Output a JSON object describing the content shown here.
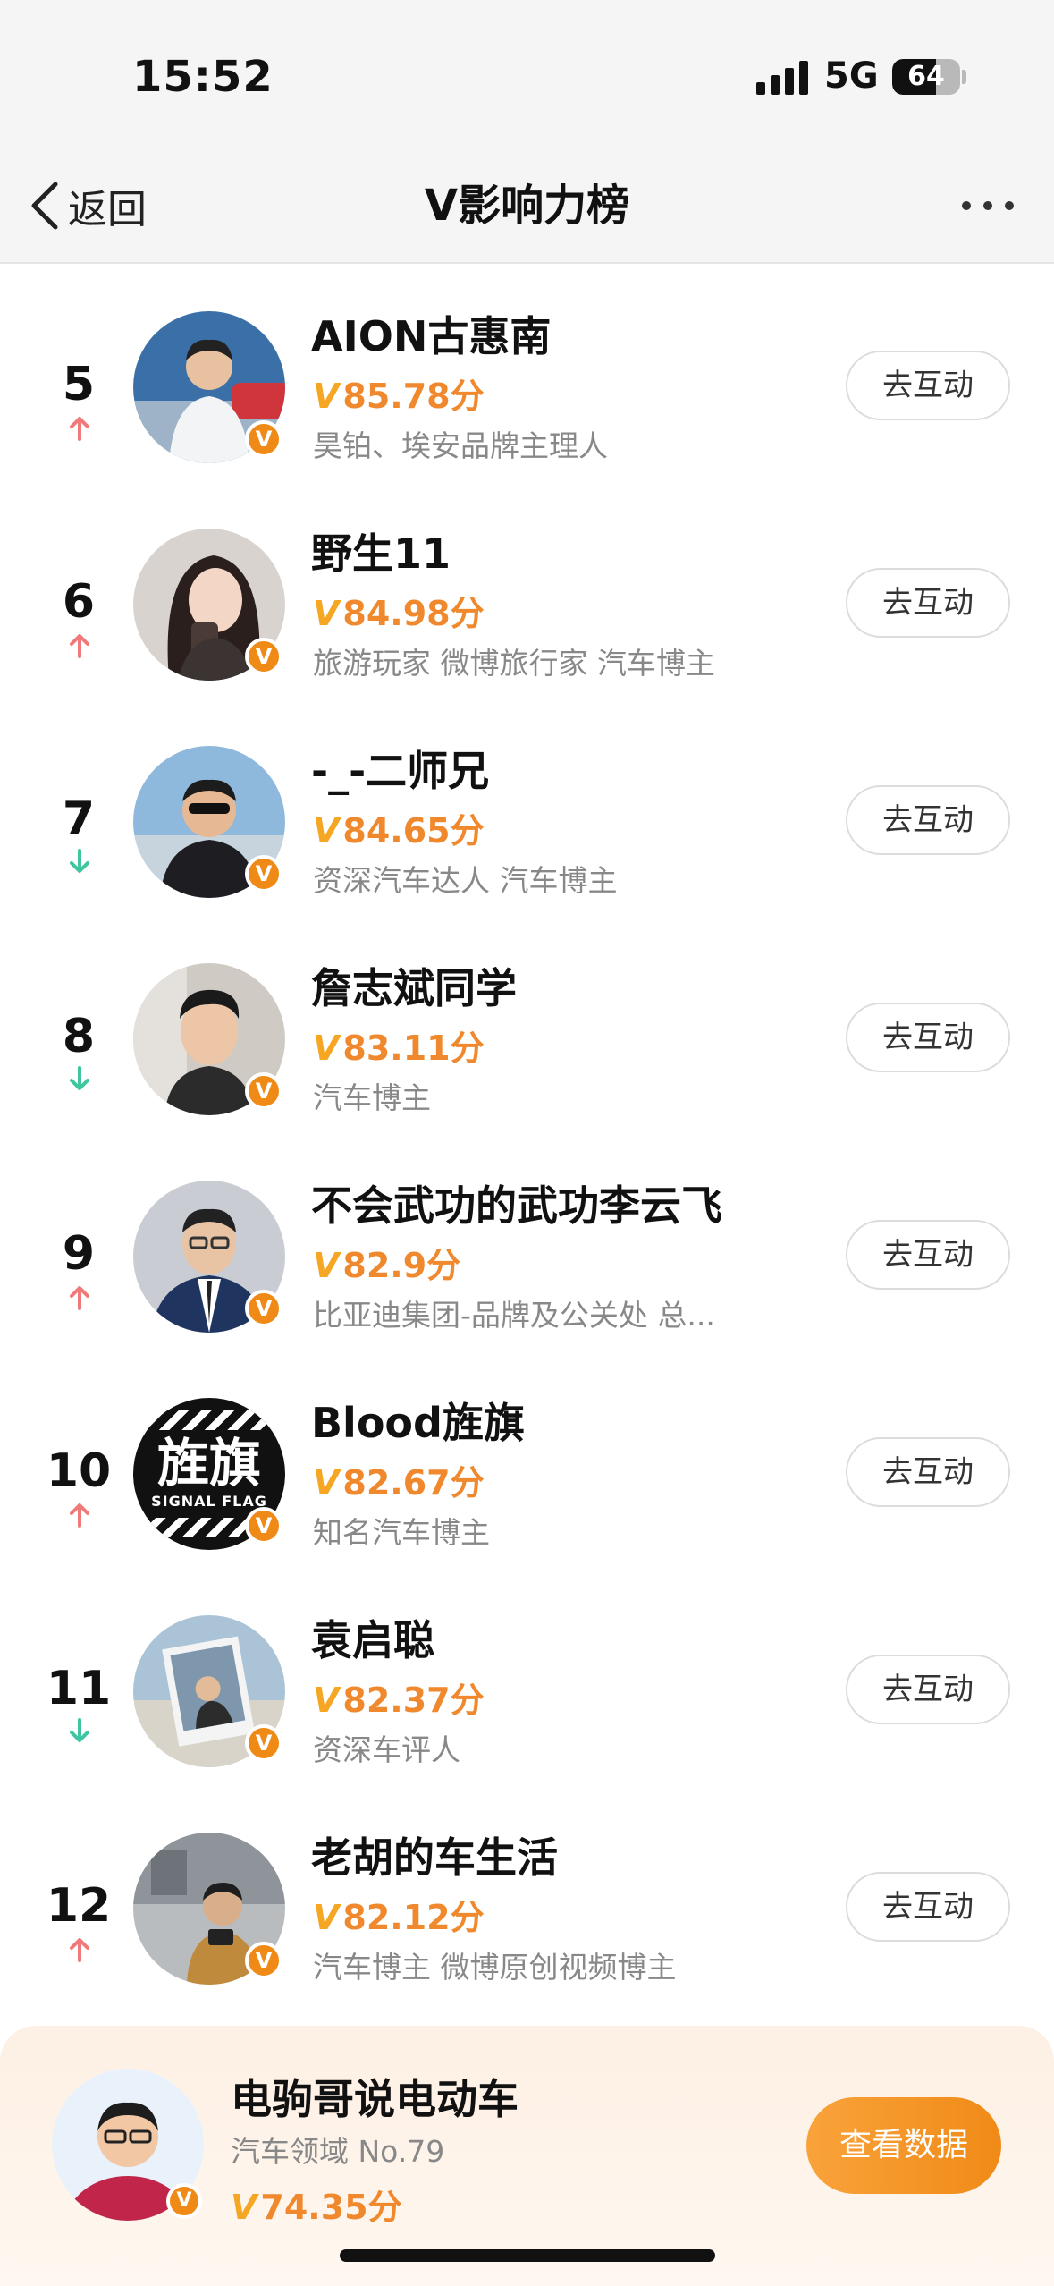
{
  "status_bar": {
    "time": "15:52",
    "network": "5G",
    "battery": "64",
    "battery_level_percent": 64
  },
  "nav": {
    "back_label": "返回",
    "title": "V影响力榜"
  },
  "colors": {
    "score": "#f0892d",
    "up": "#f07a7a",
    "down": "#3fc6a0",
    "badge": "#f08a17"
  },
  "list": [
    {
      "rank": "5",
      "trend": "up",
      "name": "AION古惠南",
      "score": "85.78分",
      "desc": "昊铂、埃安品牌主理人",
      "button": "去互动"
    },
    {
      "rank": "6",
      "trend": "up",
      "name": "野生11",
      "score": "84.98分",
      "desc": "旅游玩家 微博旅行家 汽车博主",
      "button": "去互动"
    },
    {
      "rank": "7",
      "trend": "down",
      "name": "-_-二师兄",
      "score": "84.65分",
      "desc": "资深汽车达人 汽车博主",
      "button": "去互动"
    },
    {
      "rank": "8",
      "trend": "down",
      "name": "詹志斌同学",
      "score": "83.11分",
      "desc": "汽车博主",
      "button": "去互动"
    },
    {
      "rank": "9",
      "trend": "up",
      "name": "不会武功的武功李云飞",
      "score": "82.9分",
      "desc": "比亚迪集团-品牌及公关处 总...",
      "button": "去互动"
    },
    {
      "rank": "10",
      "trend": "up",
      "name": "Blood旌旗",
      "score": "82.67分",
      "desc": "知名汽车博主",
      "button": "去互动",
      "avatar_text": "旌旗",
      "avatar_sub": "SIGNAL FLAG"
    },
    {
      "rank": "11",
      "trend": "down",
      "name": "袁启聪",
      "score": "82.37分",
      "desc": "资深车评人",
      "button": "去互动"
    },
    {
      "rank": "12",
      "trend": "up",
      "name": "老胡的车生活",
      "score": "82.12分",
      "desc": "汽车博主 微博原创视频博主",
      "button": "去互动"
    }
  ],
  "me": {
    "name": "电驹哥说电动车",
    "field": "汽车领域 No.79",
    "score": "74.35分",
    "button": "查看数据"
  },
  "v_mark": "V"
}
